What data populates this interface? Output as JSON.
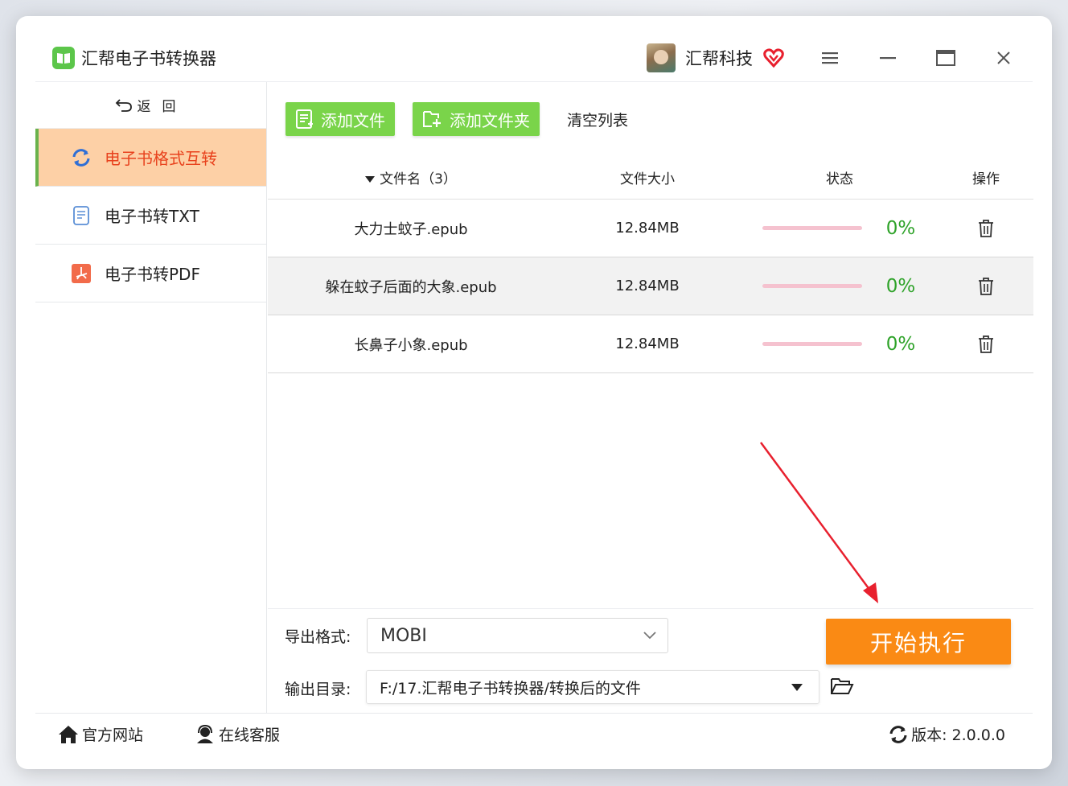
{
  "window": {
    "title": "汇帮电子书转换器"
  },
  "header": {
    "company": "汇帮科技"
  },
  "sidebar": {
    "back_label": "返回",
    "items": [
      {
        "label": "电子书格式互转",
        "active": true
      },
      {
        "label": "电子书转TXT",
        "active": false
      },
      {
        "label": "电子书转PDF",
        "active": false
      }
    ]
  },
  "toolbar": {
    "add_file": "添加文件",
    "add_folder": "添加文件夹",
    "clear_list": "清空列表"
  },
  "table": {
    "headers": {
      "name": "文件名（3）",
      "size": "文件大小",
      "status": "状态",
      "op": "操作"
    },
    "rows": [
      {
        "name": "大力士蚊子.epub",
        "size": "12.84MB",
        "progress": "0%"
      },
      {
        "name": "躲在蚊子后面的大象.epub",
        "size": "12.84MB",
        "progress": "0%"
      },
      {
        "name": "长鼻子小象.epub",
        "size": "12.84MB",
        "progress": "0%"
      }
    ]
  },
  "bottom": {
    "format_label": "导出格式:",
    "format_value": "MOBI",
    "dir_label": "输出目录:",
    "dir_value": "F:/17.汇帮电子书转换器/转换后的文件",
    "start_label": "开始执行"
  },
  "footer": {
    "website": "官方网站",
    "support": "在线客服",
    "version": "版本: 2.0.0.0"
  },
  "colors": {
    "accent_green": "#7ad44a",
    "active_bg": "#fdd0a6",
    "active_text": "#e8421d",
    "start_orange": "#fa8a14",
    "progress_text": "#2fa32a"
  }
}
